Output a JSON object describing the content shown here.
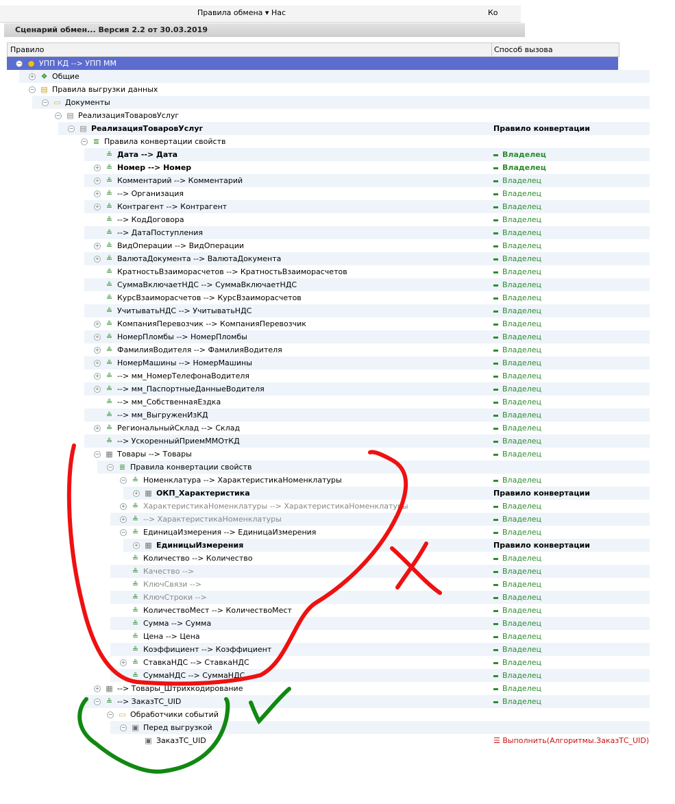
{
  "toolbar": {
    "item1": "Правила обмена ▾",
    "item2": "Нас",
    "item3": "Ко"
  },
  "titlebar": {
    "title": "Сценарий обмен... Версия 2.2 от 30.03.2019"
  },
  "header": {
    "col1": "Правило",
    "col2": "Способ вызова"
  },
  "rows": [
    {
      "label": "УПП КД --> УПП ММ",
      "indent": 1,
      "tog": "-",
      "icon": "ball",
      "sel": true,
      "call": ""
    },
    {
      "label": "Общие",
      "indent": 2,
      "tog": "+",
      "icon": "dots",
      "call": ""
    },
    {
      "label": "Правила выгрузки данных",
      "indent": 2,
      "tog": "-",
      "icon": "folder-rules",
      "call": ""
    },
    {
      "label": "Документы",
      "indent": 3,
      "tog": "-",
      "icon": "folder",
      "call": ""
    },
    {
      "label": "РеализацияТоваровУслуг",
      "indent": 4,
      "tog": "-",
      "icon": "doc",
      "call": ""
    },
    {
      "label": "РеализацияТоваровУслуг",
      "indent": 5,
      "tog": "-",
      "icon": "doc",
      "bold": true,
      "call": "Правило конвертации",
      "ct": "rule"
    },
    {
      "label": "Правила конвертации свойств",
      "indent": 6,
      "tog": "-",
      "icon": "stack",
      "call": ""
    },
    {
      "label": "Дата --> Дата",
      "indent": 7,
      "tog": "",
      "icon": "prop",
      "bold": true,
      "call": "Владелец",
      "ct": "ownb"
    },
    {
      "label": "Номер --> Номер",
      "indent": 7,
      "tog": "+",
      "icon": "prop",
      "bold": true,
      "call": "Владелец",
      "ct": "ownb"
    },
    {
      "label": "Комментарий --> Комментарий",
      "indent": 7,
      "tog": "+",
      "icon": "prop",
      "call": "Владелец",
      "ct": "own"
    },
    {
      "label": "--> Организация",
      "indent": 7,
      "tog": "+",
      "icon": "prop",
      "call": "Владелец",
      "ct": "own"
    },
    {
      "label": "Контрагент --> Контрагент",
      "indent": 7,
      "tog": "+",
      "icon": "prop",
      "call": "Владелец",
      "ct": "own"
    },
    {
      "label": "--> КодДоговора",
      "indent": 7,
      "tog": "",
      "icon": "prop",
      "call": "Владелец",
      "ct": "own"
    },
    {
      "label": " --> ДатаПоступления",
      "indent": 7,
      "tog": "",
      "icon": "prop",
      "call": "Владелец",
      "ct": "own"
    },
    {
      "label": "ВидОперации --> ВидОперации",
      "indent": 7,
      "tog": "+",
      "icon": "prop",
      "call": "Владелец",
      "ct": "own"
    },
    {
      "label": "ВалютаДокумента --> ВалютаДокумента",
      "indent": 7,
      "tog": "+",
      "icon": "prop",
      "call": "Владелец",
      "ct": "own"
    },
    {
      "label": "КратностьВзаиморасчетов --> КратностьВзаиморасчетов",
      "indent": 7,
      "tog": "",
      "icon": "prop",
      "call": "Владелец",
      "ct": "own"
    },
    {
      "label": "СуммаВключаетНДС --> СуммаВключаетНДС",
      "indent": 7,
      "tog": "",
      "icon": "prop",
      "call": "Владелец",
      "ct": "own"
    },
    {
      "label": "КурсВзаиморасчетов --> КурсВзаиморасчетов",
      "indent": 7,
      "tog": "",
      "icon": "prop",
      "call": "Владелец",
      "ct": "own"
    },
    {
      "label": "УчитыватьНДС --> УчитыватьНДС",
      "indent": 7,
      "tog": "",
      "icon": "prop",
      "call": "Владелец",
      "ct": "own"
    },
    {
      "label": "КомпанияПеревозчик --> КомпанияПеревозчик",
      "indent": 7,
      "tog": "+",
      "icon": "prop",
      "call": "Владелец",
      "ct": "own"
    },
    {
      "label": "НомерПломбы --> НомерПломбы",
      "indent": 7,
      "tog": "+",
      "icon": "prop",
      "call": "Владелец",
      "ct": "own"
    },
    {
      "label": "ФамилияВодителя --> ФамилияВодителя",
      "indent": 7,
      "tog": "+",
      "icon": "prop",
      "call": "Владелец",
      "ct": "own"
    },
    {
      "label": "НомерМашины --> НомерМашины",
      "indent": 7,
      "tog": "+",
      "icon": "prop",
      "call": "Владелец",
      "ct": "own"
    },
    {
      "label": " --> мм_НомерТелефонаВодителя",
      "indent": 7,
      "tog": "+",
      "icon": "prop",
      "call": "Владелец",
      "ct": "own"
    },
    {
      "label": " --> мм_ПаспортныеДанныеВодителя",
      "indent": 7,
      "tog": "+",
      "icon": "prop",
      "call": "Владелец",
      "ct": "own"
    },
    {
      "label": " --> мм_СобственнаяЕздка",
      "indent": 7,
      "tog": "",
      "icon": "prop",
      "call": "Владелец",
      "ct": "own"
    },
    {
      "label": " --> мм_ВыгруженИзКД",
      "indent": 7,
      "tog": "",
      "icon": "prop",
      "call": "Владелец",
      "ct": "own"
    },
    {
      "label": "РегиональныйСклад --> Склад",
      "indent": 7,
      "tog": "+",
      "icon": "prop",
      "call": "Владелец",
      "ct": "own"
    },
    {
      "label": "--> УскоренныйПриемММОтКД",
      "indent": 7,
      "tog": "",
      "icon": "prop",
      "call": "Владелец",
      "ct": "own"
    },
    {
      "label": "Товары --> Товары",
      "indent": 7,
      "tog": "-",
      "icon": "table",
      "call": "Владелец",
      "ct": "own"
    },
    {
      "label": "Правила конвертации свойств",
      "indent": 8,
      "tog": "-",
      "icon": "stack",
      "call": ""
    },
    {
      "label": "Номенклатура --> ХарактеристикаНоменклатуры",
      "indent": 9,
      "tog": "-",
      "icon": "prop",
      "call": "Владелец",
      "ct": "own"
    },
    {
      "label": "ОКП_Характеристика",
      "indent": 10,
      "tog": "+",
      "icon": "table",
      "bold": true,
      "call": "Правило конвертации",
      "ct": "rule"
    },
    {
      "label": "ХарактеристикаНоменклатуры --> ХарактеристикаНоменклатуры",
      "indent": 9,
      "tog": "+",
      "icon": "prop",
      "gray": true,
      "call": "Владелец",
      "ct": "own"
    },
    {
      "label": "--> ХарактеристикаНоменклатуры",
      "indent": 9,
      "tog": "+",
      "icon": "prop",
      "gray": true,
      "call": "Владелец",
      "ct": "own"
    },
    {
      "label": "ЕдиницаИзмерения --> ЕдиницаИзмерения",
      "indent": 9,
      "tog": "-",
      "icon": "prop",
      "call": "Владелец",
      "ct": "own"
    },
    {
      "label": "ЕдиницыИзмерения",
      "indent": 10,
      "tog": "+",
      "icon": "table",
      "bold": true,
      "call": "Правило конвертации",
      "ct": "rule"
    },
    {
      "label": "Количество --> Количество",
      "indent": 9,
      "tog": "",
      "icon": "prop",
      "call": "Владелец",
      "ct": "own"
    },
    {
      "label": "Качество -->",
      "indent": 9,
      "tog": "",
      "icon": "prop",
      "gray": true,
      "call": "Владелец",
      "ct": "own"
    },
    {
      "label": "КлючСвязи -->",
      "indent": 9,
      "tog": "",
      "icon": "prop",
      "gray": true,
      "call": "Владелец",
      "ct": "own"
    },
    {
      "label": "КлючСтроки -->",
      "indent": 9,
      "tog": "",
      "icon": "prop",
      "gray": true,
      "call": "Владелец",
      "ct": "own"
    },
    {
      "label": "КоличествоМест --> КоличествоМест",
      "indent": 9,
      "tog": "",
      "icon": "prop",
      "call": "Владелец",
      "ct": "own"
    },
    {
      "label": "Сумма --> Сумма",
      "indent": 9,
      "tog": "",
      "icon": "prop",
      "call": "Владелец",
      "ct": "own"
    },
    {
      "label": "Цена --> Цена",
      "indent": 9,
      "tog": "",
      "icon": "prop",
      "call": "Владелец",
      "ct": "own"
    },
    {
      "label": "Коэффициент --> Коэффициент",
      "indent": 9,
      "tog": "",
      "icon": "prop",
      "call": "Владелец",
      "ct": "own"
    },
    {
      "label": "СтавкаНДС --> СтавкаНДС",
      "indent": 9,
      "tog": "+",
      "icon": "prop",
      "call": "Владелец",
      "ct": "own"
    },
    {
      "label": "СуммаНДС --> СуммаНДС",
      "indent": 9,
      "tog": "",
      "icon": "prop",
      "call": "Владелец",
      "ct": "own"
    },
    {
      "label": "--> Товары_Штрихкодирование",
      "indent": 7,
      "tog": "+",
      "icon": "table",
      "call": "Владелец",
      "ct": "own"
    },
    {
      "label": "--> ЗаказТС_UID",
      "indent": 7,
      "tog": "-",
      "icon": "prop",
      "call": "Владелец",
      "ct": "own"
    },
    {
      "label": "Обработчики событий",
      "indent": 8,
      "tog": "-",
      "icon": "folder-ev",
      "call": ""
    },
    {
      "label": "Перед выгрузкой",
      "indent": 9,
      "tog": "-",
      "icon": "handler",
      "call": ""
    },
    {
      "label": "ЗаказТС_UID",
      "indent": 10,
      "tog": "",
      "icon": "handler",
      "call": "Выполнить(Алгоритмы.ЗаказТС_UID)",
      "ct": "exec"
    }
  ]
}
